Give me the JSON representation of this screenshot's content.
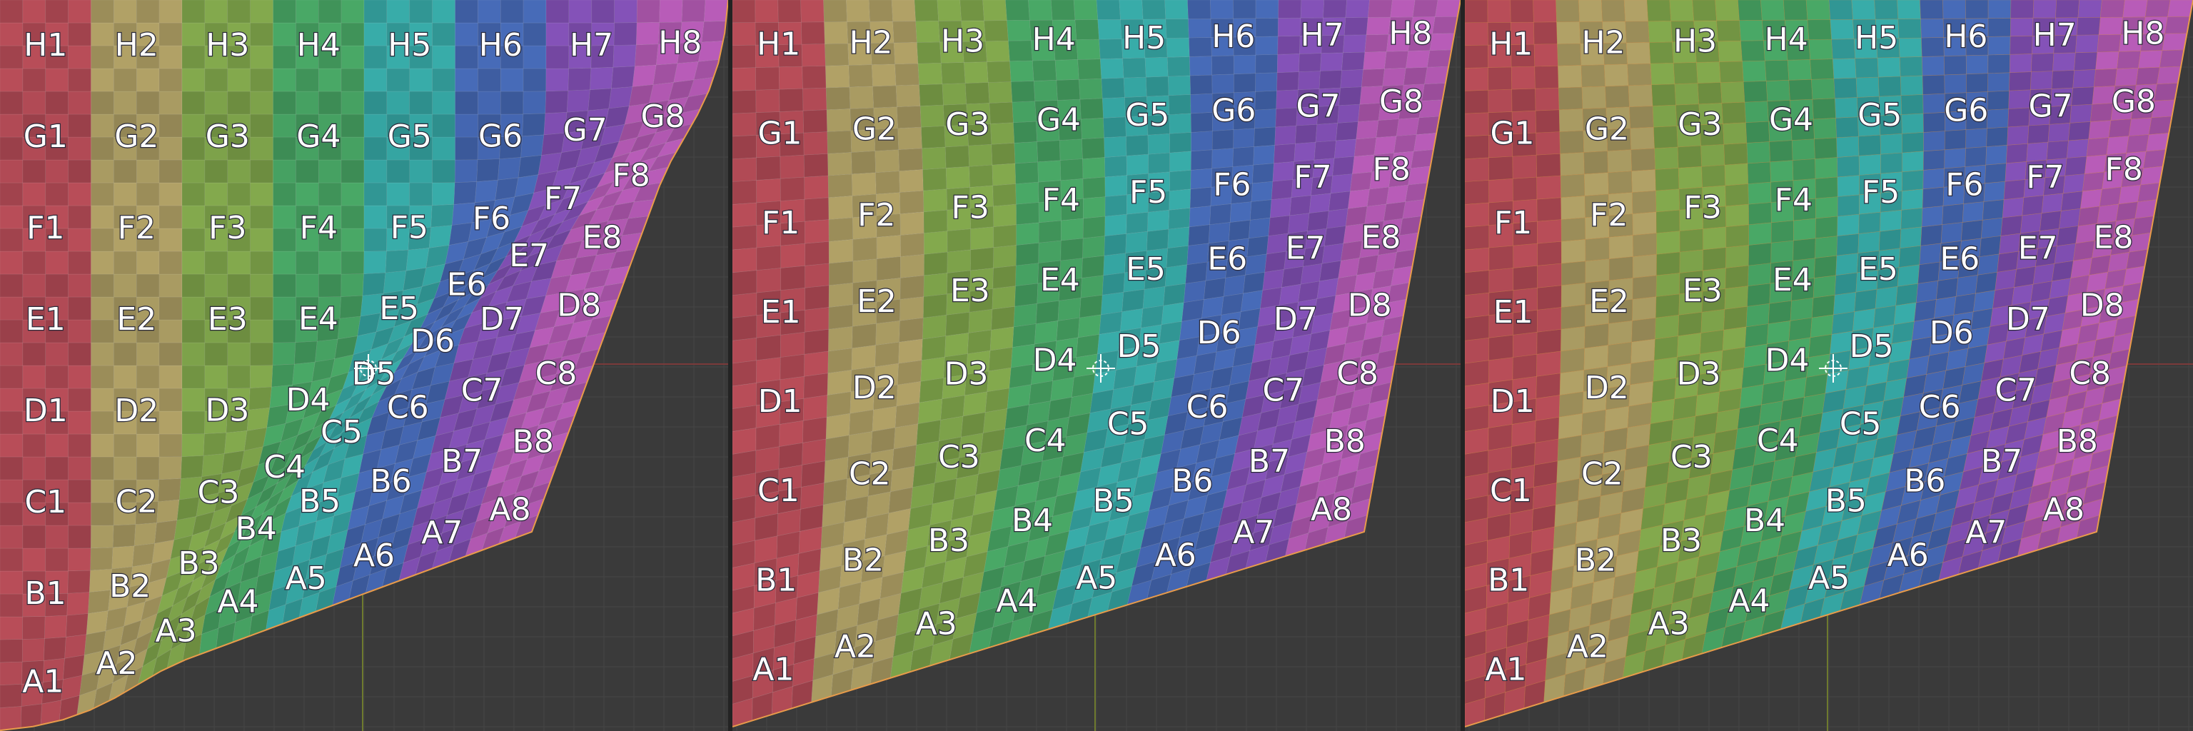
{
  "viewports": [
    {
      "name": "viewport-left",
      "style": "pinch-corner"
    },
    {
      "name": "viewport-middle",
      "style": "warp"
    },
    {
      "name": "viewport-right",
      "style": "warp-orange"
    }
  ],
  "grid": {
    "rows": [
      "A",
      "B",
      "C",
      "D",
      "E",
      "F",
      "G",
      "H"
    ],
    "cols": [
      "1",
      "2",
      "3",
      "4",
      "5",
      "6",
      "7",
      "8"
    ]
  },
  "colors": {
    "viewport_bg": "#3a3a3a",
    "grid_line": "#454545",
    "axis_x": "#7a3a3a",
    "axis_y": "#6e7a2e",
    "edge_highlight": "#e89b4a",
    "cursor": "#ffffff",
    "columns": [
      "#c0505c",
      "#b8a86a",
      "#88b050",
      "#4caf6a",
      "#3ab3b0",
      "#4a6fc0",
      "#8a55c0",
      "#c060c0"
    ]
  },
  "icons": [
    "3d-cursor-icon"
  ]
}
